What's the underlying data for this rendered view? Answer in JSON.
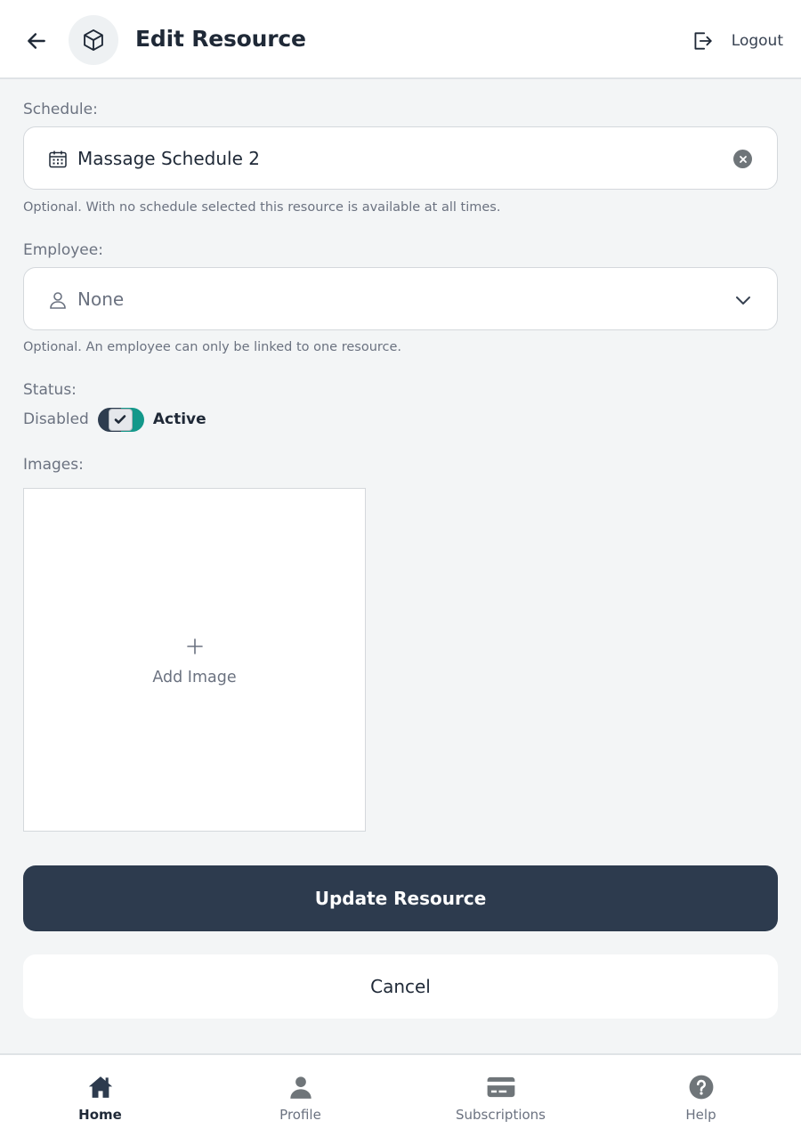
{
  "header": {
    "title": "Edit Resource",
    "back_icon": "arrow-left-icon",
    "resource_icon": "cube-icon",
    "logout_label": "Logout",
    "logout_icon": "logout-icon"
  },
  "form": {
    "schedule": {
      "label": "Schedule:",
      "value": "Massage Schedule 2",
      "icon": "calendar-icon",
      "hint": "Optional. With no schedule selected this resource is available at all times."
    },
    "employee": {
      "label": "Employee:",
      "value": "None",
      "icon": "user-icon",
      "hint": "Optional. An employee can only be linked to one resource."
    },
    "status": {
      "label": "Status:",
      "off_label": "Disabled",
      "on_label": "Active",
      "checked": true
    },
    "images": {
      "label": "Images:",
      "add_label": "Add Image"
    }
  },
  "actions": {
    "submit_label": "Update Resource",
    "cancel_label": "Cancel"
  },
  "nav": {
    "items": [
      {
        "label": "Home",
        "icon": "home-icon",
        "active": true
      },
      {
        "label": "Profile",
        "icon": "user-icon",
        "active": false
      },
      {
        "label": "Subscriptions",
        "icon": "credit-card-icon",
        "active": false
      },
      {
        "label": "Help",
        "icon": "help-icon",
        "active": false
      }
    ]
  },
  "colors": {
    "primary": "#2d3b4e",
    "accent": "#13988a",
    "background": "#f3f5f6"
  }
}
